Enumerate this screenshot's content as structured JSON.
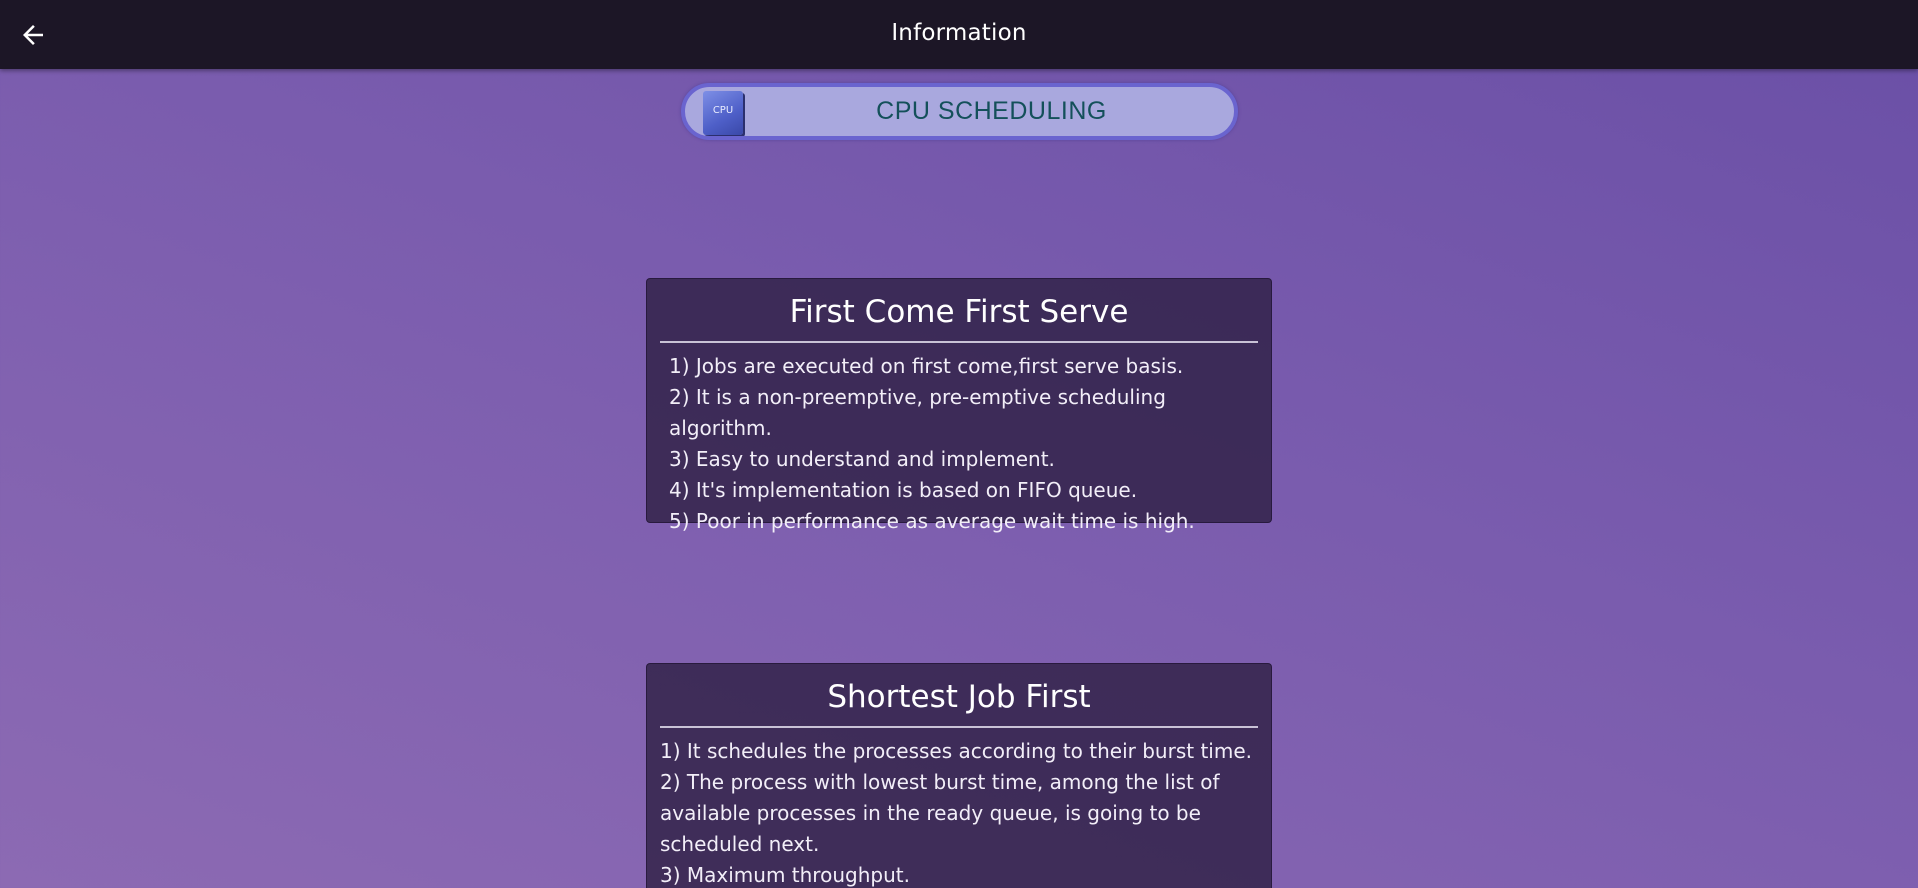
{
  "header": {
    "title": "Information",
    "back_icon": "arrow-left-icon"
  },
  "banner": {
    "chip_label": "CPU",
    "label": "CPU SCHEDULING",
    "chip_icon": "cpu-chip-icon"
  },
  "cards": [
    {
      "title": "First Come First Serve",
      "items": [
        "1) Jobs are executed on first come,first serve basis.",
        "2) It is a non-preemptive, pre-emptive scheduling algorithm.",
        "3) Easy to understand and implement.",
        "4) It's implementation is based on FIFO queue.",
        "5) Poor in performance as average wait time is high."
      ]
    },
    {
      "title": "Shortest Job First",
      "items": [
        "1) It schedules the processes according to their burst time.",
        "2) The process with lowest burst time, among the list of available processes in the ready queue, is going to be scheduled next.",
        "3) Maximum throughput."
      ]
    }
  ],
  "colors": {
    "topbar": "#1c1626",
    "pill_background": "#a9a8de",
    "pill_border": "#6a64cf",
    "pill_text": "#14505a",
    "card_background": "#2c1e40"
  }
}
